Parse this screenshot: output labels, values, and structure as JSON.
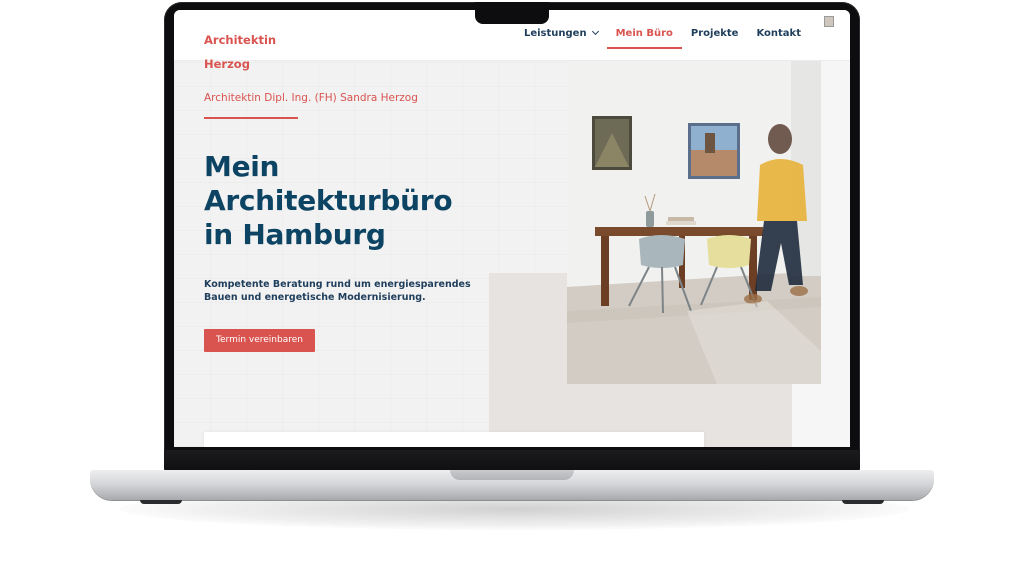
{
  "site": {
    "logo_line1": "Architektin",
    "logo_line2": "Herzog",
    "nav": {
      "services": "Leistungen",
      "office": "Mein Büro",
      "projects": "Projekte",
      "contact": "Kontakt"
    },
    "hero": {
      "eyebrow": "Architektin Dipl. Ing. (FH) Sandra Herzog",
      "title_line1": "Mein",
      "title_line2": "Architekturbüro",
      "title_line3": "in Hamburg",
      "subtitle_line1": "Kompetente Beratung rund um energiesparendes",
      "subtitle_line2": "Bauen und energetische Modernisierung.",
      "cta": "Termin vereinbaren"
    }
  },
  "colors": {
    "accent": "#d9534f",
    "navy": "#0d4463",
    "nav_text": "#1f3e5c",
    "beige": "#e7e3e1"
  },
  "icons": {
    "dropdown": "chevron-down-icon"
  }
}
